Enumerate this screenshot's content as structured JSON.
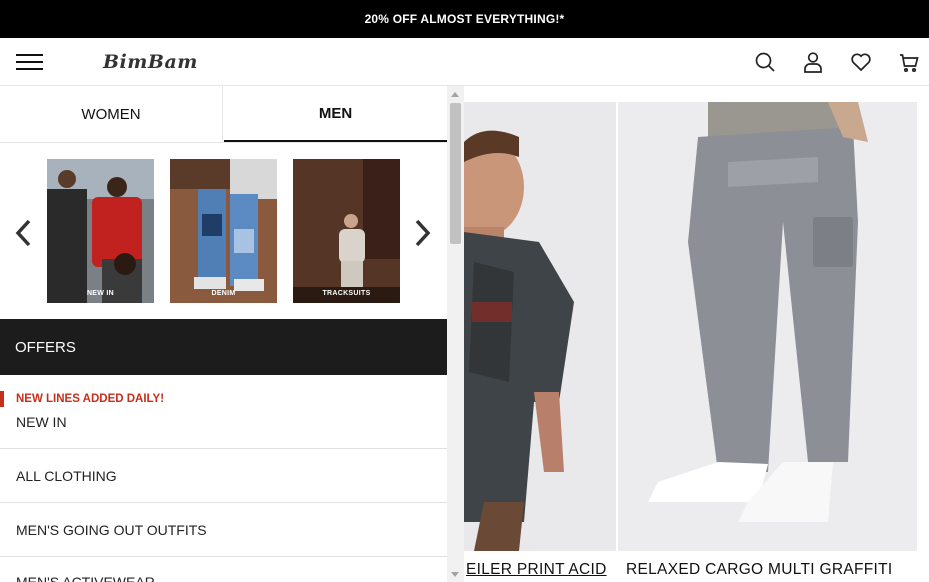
{
  "promo": {
    "text": "20% OFF ALMOST EVERYTHING!*"
  },
  "header": {
    "logo": "BimBam",
    "icons": [
      "menu-icon",
      "search-icon",
      "account-icon",
      "wishlist-icon",
      "bag-icon"
    ]
  },
  "menu": {
    "tabs": [
      {
        "label": "WOMEN",
        "active": false
      },
      {
        "label": "MEN",
        "active": true
      }
    ],
    "carousel": [
      {
        "label": "NEW IN"
      },
      {
        "label": "DENIM"
      },
      {
        "label": "TRACKSUITS"
      }
    ],
    "offers_label": "OFFERS",
    "items": [
      {
        "tag": "NEW LINES ADDED DAILY!",
        "label": "NEW IN"
      },
      {
        "label": "ALL CLOTHING"
      },
      {
        "label": "MEN'S GOING OUT OUTFITS"
      },
      {
        "label": "MEN'S ACTIVEWEAR"
      }
    ]
  },
  "products": [
    {
      "title": "EILER PRINT ACID"
    },
    {
      "title": "RELAXED CARGO MULTI GRAFFITI"
    }
  ],
  "colors": {
    "accent": "#c6301a",
    "promo_bg": "#000000",
    "offers_bg": "#1c1c1c"
  }
}
